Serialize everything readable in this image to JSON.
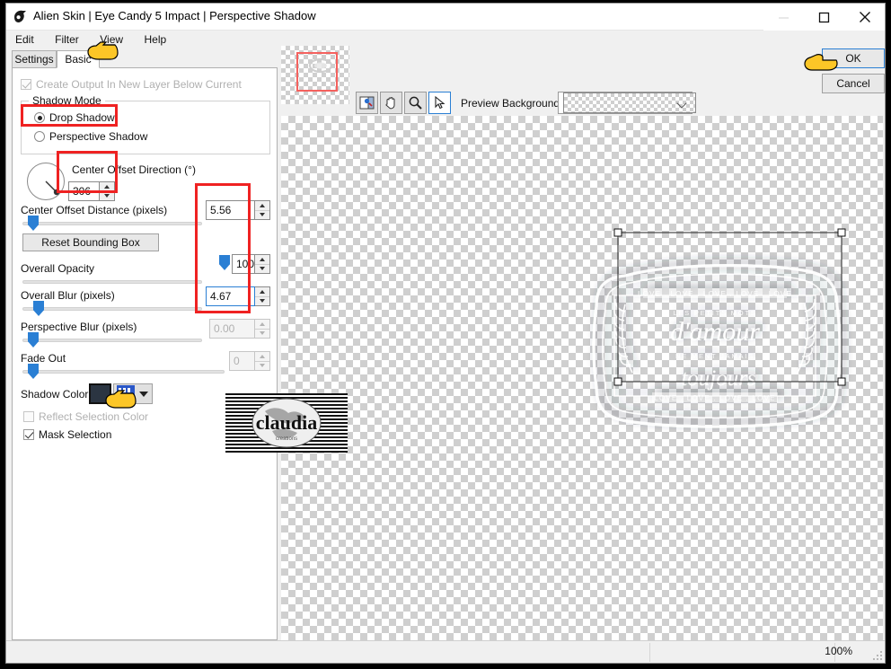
{
  "window": {
    "title": "Alien Skin | Eye Candy 5 Impact | Perspective Shadow",
    "icon": "app-logo-icon",
    "minimize": "minimize-icon",
    "maximize": "maximize-icon",
    "close": "close-icon"
  },
  "menu": {
    "items": [
      {
        "label": "Edit"
      },
      {
        "label": "Filter"
      },
      {
        "label": "View"
      },
      {
        "label": "Help"
      }
    ]
  },
  "tabs": [
    {
      "label": "Settings",
      "selected": false
    },
    {
      "label": "Basic",
      "selected": true
    }
  ],
  "panel": {
    "create_output": {
      "label": "Create Output In New Layer Below Current",
      "checked": true,
      "enabled": false
    },
    "shadow_mode": {
      "group_label": "Shadow Mode",
      "options": [
        {
          "label": "Drop Shadow",
          "selected": true
        },
        {
          "label": "Perspective Shadow",
          "selected": false
        }
      ]
    },
    "center_offset_direction": {
      "label": "Center Offset Direction (°)",
      "value": "306",
      "dial": "angle-dial"
    },
    "center_offset_distance": {
      "label": "Center Offset Distance (pixels)",
      "value": "5.56",
      "slider_pct": 4,
      "enabled": true
    },
    "reset_bounding_box": {
      "label": "Reset Bounding Box"
    },
    "overall_opacity": {
      "label": "Overall Opacity",
      "value": "100",
      "slider_pct": 100,
      "enabled": true
    },
    "overall_blur": {
      "label": "Overall Blur (pixels)",
      "value": "4.67",
      "slider_pct": 9,
      "enabled": true,
      "focused": true
    },
    "perspective_blur": {
      "label": "Perspective Blur (pixels)",
      "value": "0.00",
      "slider_pct": 1,
      "enabled": false
    },
    "fade_out": {
      "label": "Fade Out",
      "value": "0",
      "slider_pct": 1,
      "enabled": false
    },
    "shadow_color": {
      "label": "Shadow Color",
      "color": "#2b3542",
      "dropdown": "color-dropdown-icon"
    },
    "reflect_selection_color": {
      "label": "Reflect Selection Color",
      "checked": false,
      "enabled": false
    },
    "mask_selection": {
      "label": "Mask Selection",
      "checked": true,
      "enabled": true
    }
  },
  "preview": {
    "navigator": "navigator-thumbnail",
    "tools": [
      {
        "name": "preview-toggle-tool",
        "selected": false
      },
      {
        "name": "hand-tool",
        "selected": false
      },
      {
        "name": "zoom-tool",
        "selected": false
      },
      {
        "name": "arrow-tool",
        "selected": true
      }
    ],
    "background_label": "Preview Background:",
    "background_value": "None",
    "artwork_alt": "amour-toujours-label",
    "artwork_text": {
      "top_banner": "LOVE . LOVE . LOVE . LOVE . LOVE",
      "line1": "LES PETITS MOTS",
      "line2": "d'amour",
      "line3": "NE MENT JAMAIS",
      "line4": "toujours",
      "bottom_banner": "LOVE . LOVE . LOVE . LOVE"
    }
  },
  "actions": {
    "ok": "OK",
    "cancel": "Cancel"
  },
  "statusbar": {
    "zoom": "100%",
    "grip": "resize-grip-icon"
  },
  "watermark": {
    "text": "claudia"
  },
  "annotations": {
    "accent_color": "#ef2222",
    "cursor": "pointing-hand-cursor"
  }
}
